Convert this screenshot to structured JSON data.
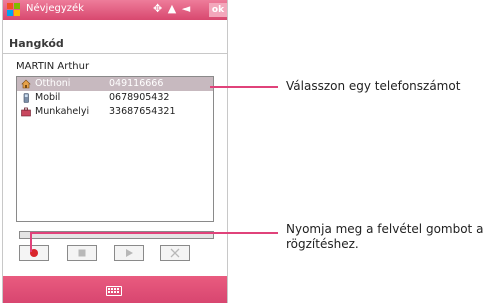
{
  "titlebar": {
    "app_title": "Névjegyzék",
    "status_icons": "✦ᵧᵢl ◀€",
    "ok_label": "ok"
  },
  "page": {
    "title": "Hangkód",
    "contact_name": "MARTIN Arthur"
  },
  "phones": [
    {
      "label": "Otthoni",
      "number": "049116666",
      "icon": "home-icon",
      "selected": true
    },
    {
      "label": "Mobil",
      "number": "0678905432",
      "icon": "mobile-phone-icon",
      "selected": false
    },
    {
      "label": "Munkahelyi",
      "number": "33687654321",
      "icon": "briefcase-icon",
      "selected": false
    }
  ],
  "controls": {
    "record": "record-icon",
    "stop": "stop-icon",
    "play": "play-icon",
    "delete": "delete-icon"
  },
  "callouts": {
    "top": "Válasszon egy telefonszámot",
    "bottom_line1": "Nyomja meg a felvétel gombot a",
    "bottom_line2": "rögzítéshez."
  },
  "colors": {
    "accent": "#d84670",
    "callout_line": "#e0427a",
    "selection": "#c7b9bf"
  }
}
